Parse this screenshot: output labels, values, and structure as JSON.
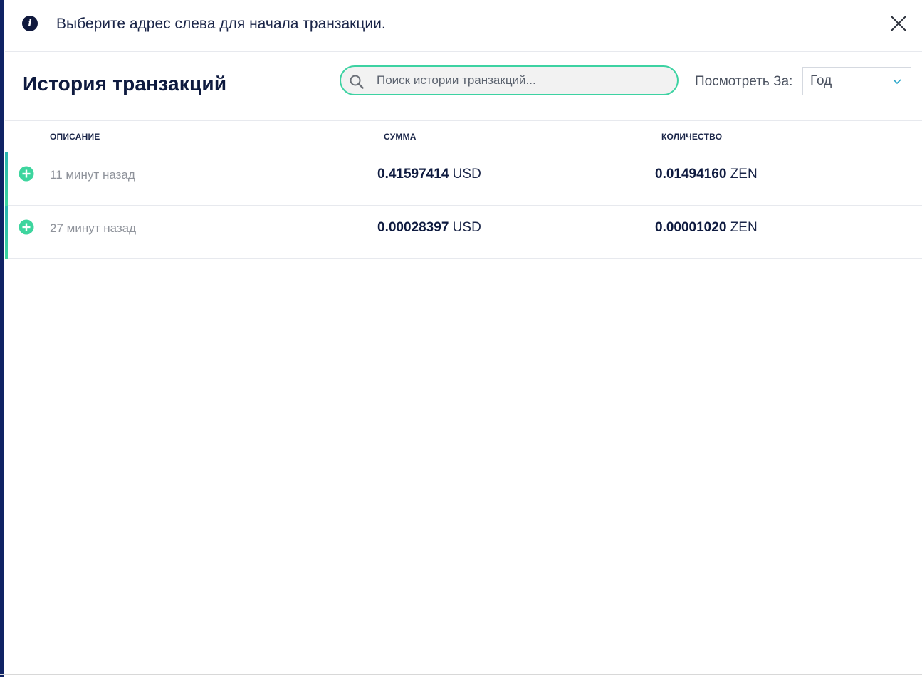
{
  "notice": {
    "icon": "info-icon",
    "text": "Выберите адрес слева для начала транзакции."
  },
  "header": {
    "title": "История транзакций",
    "search": {
      "placeholder": "Поиск истории транзакций...",
      "value": ""
    },
    "view_label": "Посмотреть За:",
    "period": {
      "selected": "Год"
    }
  },
  "table": {
    "columns": [
      "ОПИСАНИЕ",
      "СУММА",
      "КОЛИЧЕСТВО"
    ],
    "rows": [
      {
        "time": "11 минут назад",
        "amount": "0.41597414",
        "amount_unit": "USD",
        "quantity": "0.01494160",
        "quantity_unit": "ZEN"
      },
      {
        "time": "27 минут назад",
        "amount": "0.00028397",
        "amount_unit": "USD",
        "quantity": "0.00001020",
        "quantity_unit": "ZEN"
      }
    ]
  },
  "colors": {
    "accent": "#3dd2a2",
    "title": "#0e1a3f",
    "sidebar": "#0f2364"
  }
}
